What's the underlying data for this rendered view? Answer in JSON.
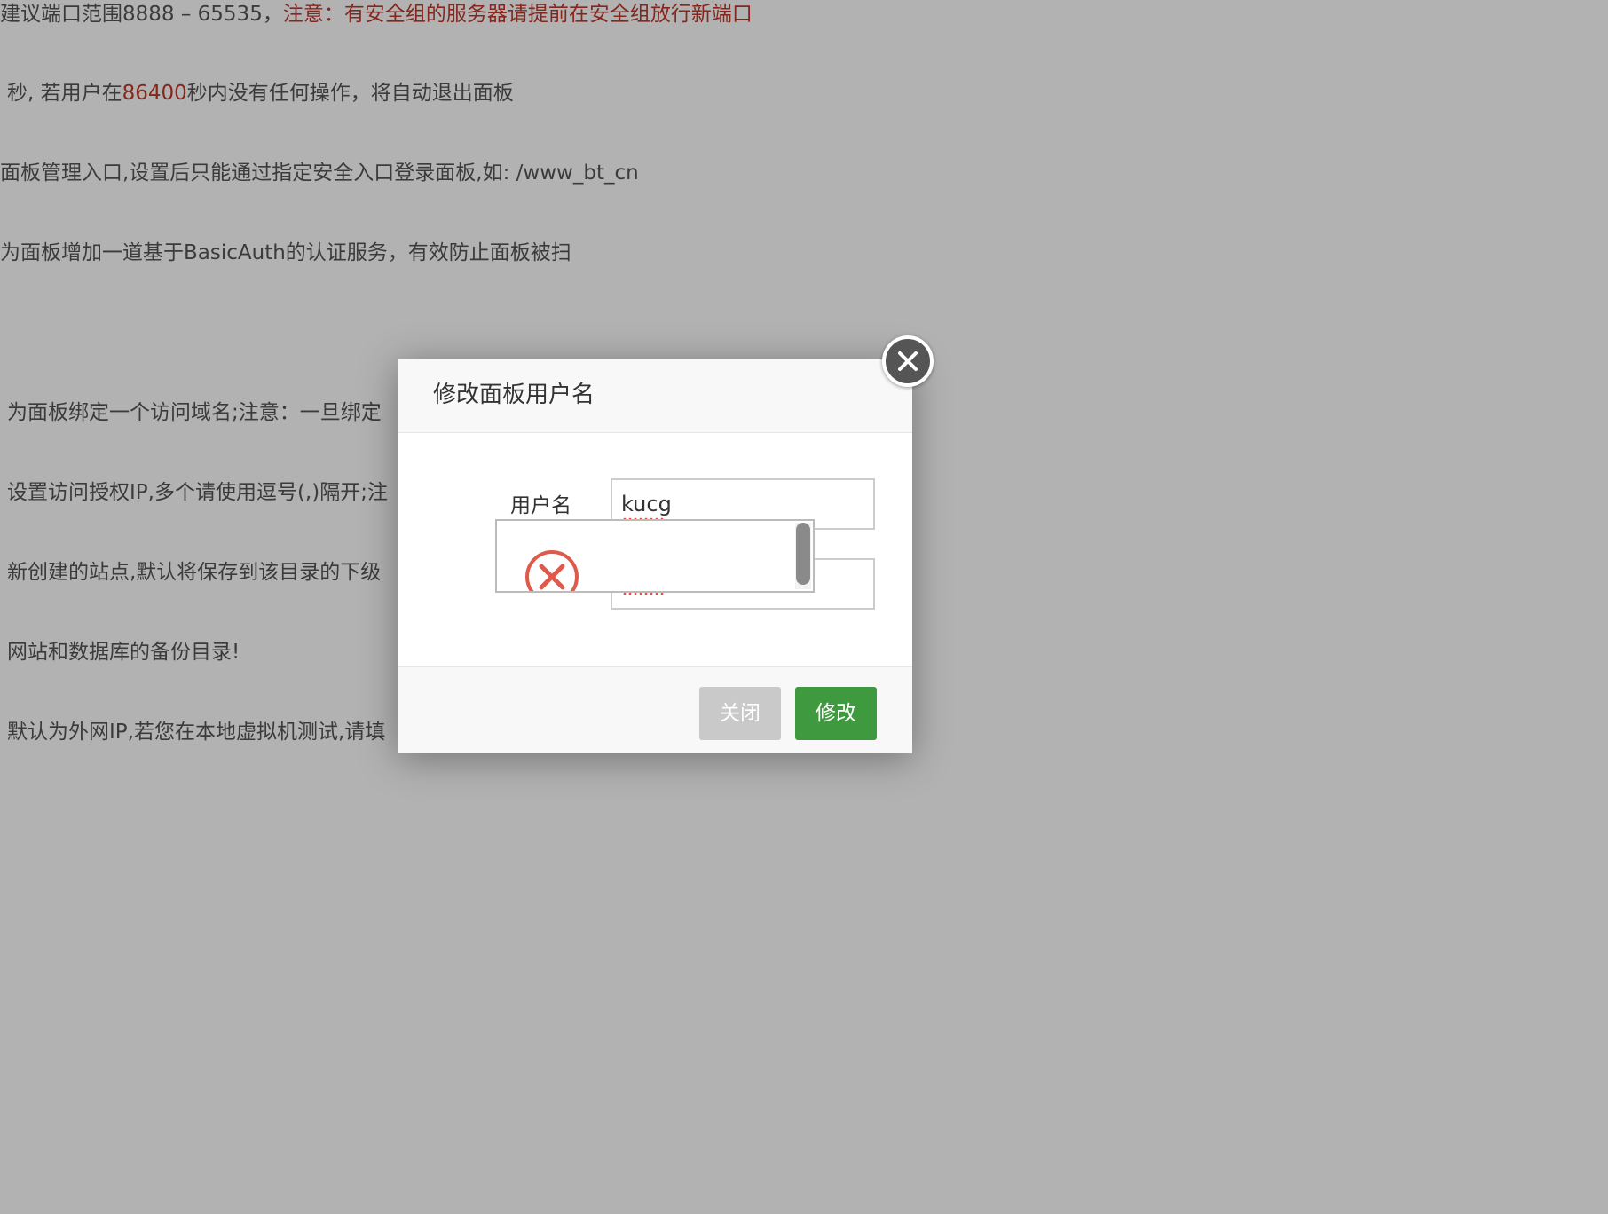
{
  "background": {
    "port_hint_prefix": "建议端口范围8888 – 65535，",
    "port_hint_warning": "注意：有安全组的服务器请提前在安全组放行新端口",
    "timeout_prefix": "秒, 若用户在",
    "timeout_value": "86400",
    "timeout_suffix": "秒内没有任何操作，将自动退出面板",
    "entry_hint": "面板管理入口,设置后只能通过指定安全入口登录面板,如: /www_bt_cn",
    "basicauth_hint": "为面板增加一道基于BasicAuth的认证服务，有效防止面板被扫",
    "domain_hint": "为面板绑定一个访问域名;注意：一旦绑定",
    "ip_hint": "设置访问授权IP,多个请使用逗号(,)隔开;注",
    "site_dir_hint": "新创建的站点,默认将保存到该目录的下级",
    "backup_hint": "网站和数据库的备份目录!",
    "public_ip_hint": "默认为外网IP,若您在本地虚拟机测试,请填"
  },
  "dialog": {
    "title": "修改面板用户名",
    "username_label": "用户名",
    "username_value": "kucg",
    "buttons": {
      "close": "关闭",
      "modify": "修改"
    }
  },
  "icons": {
    "dialog_close": "close-circle-icon",
    "error": "error-circle-x-icon"
  },
  "colors": {
    "warning_red": "#c0392b",
    "primary_green": "#3f9a3f",
    "disabled_gray": "#c9c9c9"
  }
}
